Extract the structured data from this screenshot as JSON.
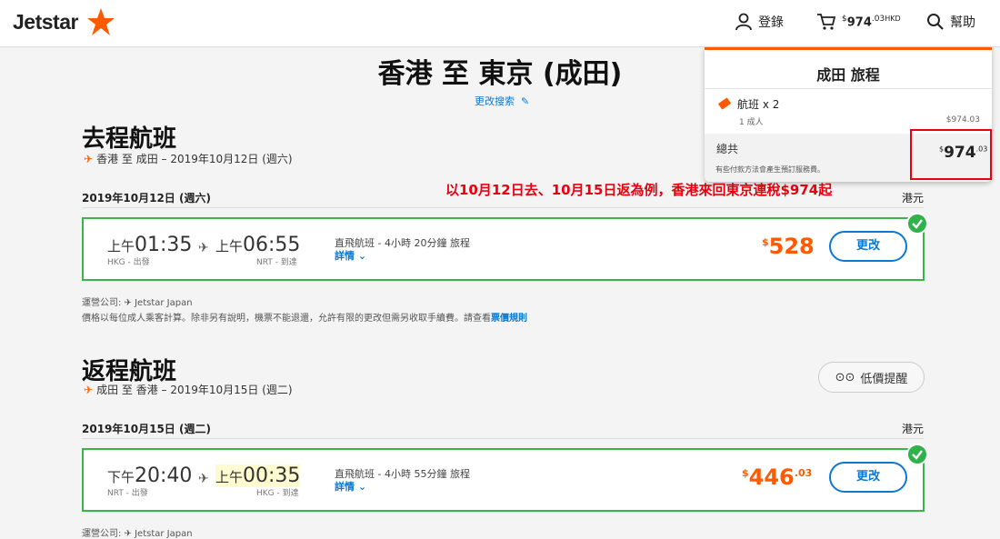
{
  "header": {
    "brand": "Jetstar",
    "login": "登錄",
    "cart_currency_sup": "$",
    "cart_amount": "974",
    "cart_cents": ".03",
    "cart_code": "HKD",
    "help": "幫助"
  },
  "page_title": "香港 至 東京 (成田)",
  "modify_search": "更改搜索",
  "annotation": "以10月12日去、10月15日返為例，香港來回東京連稅$974起",
  "outbound": {
    "title": "去程航班",
    "route": "香港 至 成田",
    "date_suffix": "– 2019年10月12日 (週六)",
    "date_header": "2019年10月12日 (週六)",
    "currency": "港元",
    "dep_ampm": "上午",
    "dep_time": "01:35",
    "arr_ampm": "上午",
    "arr_time": "06:55",
    "dep_airport": "HKG - 出發",
    "arr_airport": "NRT - 到達",
    "info": "直飛航班 - 4小時 20分鐘 旅程",
    "details": "詳情",
    "fare_sup": "$",
    "fare": "528",
    "fare_cents": "",
    "change": "更改",
    "operator": "運營公司: ✈ Jetstar Japan",
    "note": "價格以每位成人乘客計算。除非另有說明，機票不能退還，允許有限的更改但需另收取手續費。請查看",
    "note_link": "票價規則"
  },
  "inbound": {
    "title": "返程航班",
    "route": "成田 至 香港",
    "date_suffix": "– 2019年10月15日 (週二)",
    "date_header": "2019年10月15日 (週二)",
    "currency": "港元",
    "dep_ampm": "下午",
    "dep_time": "20:40",
    "arr_ampm": "上午",
    "arr_time": "00:35",
    "dep_airport": "NRT - 出發",
    "arr_airport": "HKG - 到達",
    "info": "直飛航班 - 4小時 55分鐘 旅程",
    "details": "詳情",
    "fare_sup": "$",
    "fare": "446",
    "fare_cents": ".03",
    "change": "更改",
    "price_alert": "低價提醒",
    "operator": "運營公司: ✈ Jetstar Japan"
  },
  "cart_panel": {
    "title": "成田 旅程",
    "item": "航班 x 2",
    "pax": "1 成人",
    "item_amount": "$974.03",
    "total_label": "總共",
    "total_sup": "$",
    "total": "974",
    "total_cents": ".03",
    "note": "有些付款方法會產生預訂服務費。"
  },
  "colors": {
    "accent": "#ff5a00",
    "link": "#0a78d2",
    "selected": "#3bb54a",
    "highlight": "#e8000f"
  }
}
